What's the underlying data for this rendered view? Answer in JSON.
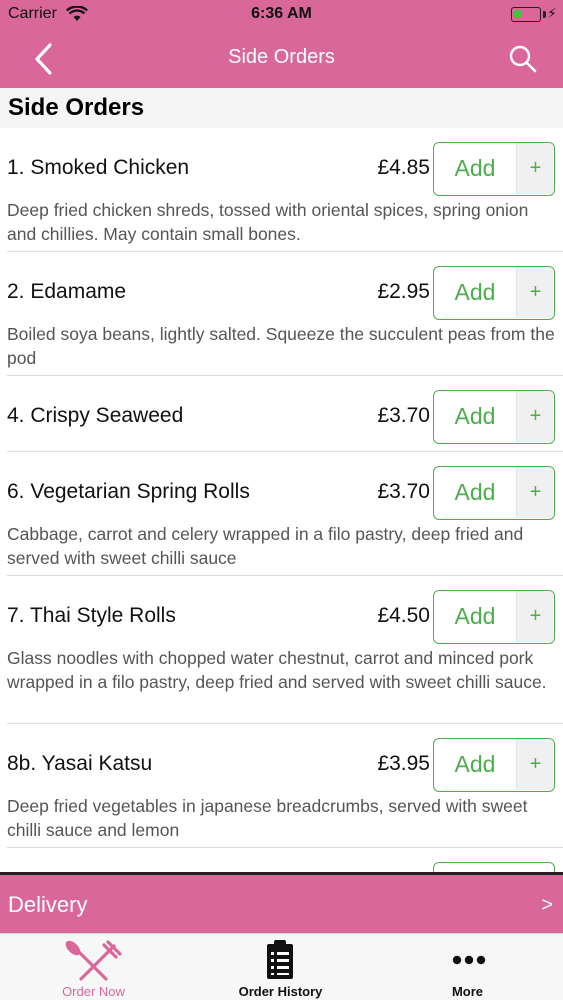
{
  "status_bar": {
    "carrier": "Carrier",
    "time": "6:36 AM",
    "battery_level": 0.3,
    "battery_color": "#3ec43e"
  },
  "nav": {
    "title": "Side Orders",
    "back_icon": "chevron-left-icon",
    "search_icon": "search-icon",
    "bar_color": "#d9679a"
  },
  "section": {
    "title": "Side Orders"
  },
  "add_button": {
    "label": "Add",
    "plus": "+",
    "color": "#4cae4c"
  },
  "items": [
    {
      "name": "1. Smoked Chicken",
      "price": "£4.85",
      "description": "Deep fried chicken shreds, tossed with oriental spices, spring onion and chillies. May contain small bones."
    },
    {
      "name": "2. Edamame",
      "price": "£2.95",
      "description": "Boiled soya beans, lightly salted. Squeeze the succulent peas from the pod"
    },
    {
      "name": "4. Crispy Seaweed",
      "price": "£3.70",
      "description": ""
    },
    {
      "name": "6. Vegetarian Spring Rolls",
      "price": "£3.70",
      "description": "Cabbage, carrot and celery wrapped in a filo pastry, deep fried and served with sweet chilli sauce"
    },
    {
      "name": "7. Thai Style Rolls",
      "price": "£4.50",
      "description": "Glass noodles with chopped water chestnut, carrot and minced pork wrapped in a filo pastry, deep fried and served with sweet chilli sauce."
    },
    {
      "name": "8b. Yasai Katsu",
      "price": "£3.95",
      "description": "Deep fried vegetables in japanese breadcrumbs, served with sweet chilli sauce and lemon"
    }
  ],
  "delivery": {
    "label": "Delivery",
    "arrow": ">"
  },
  "tabs": [
    {
      "label": "Order Now",
      "icon": "fork-knife-icon",
      "active": true
    },
    {
      "label": "Order History",
      "icon": "clipboard-icon",
      "active": false
    },
    {
      "label": "More",
      "icon": "more-dots-icon",
      "active": false
    }
  ]
}
